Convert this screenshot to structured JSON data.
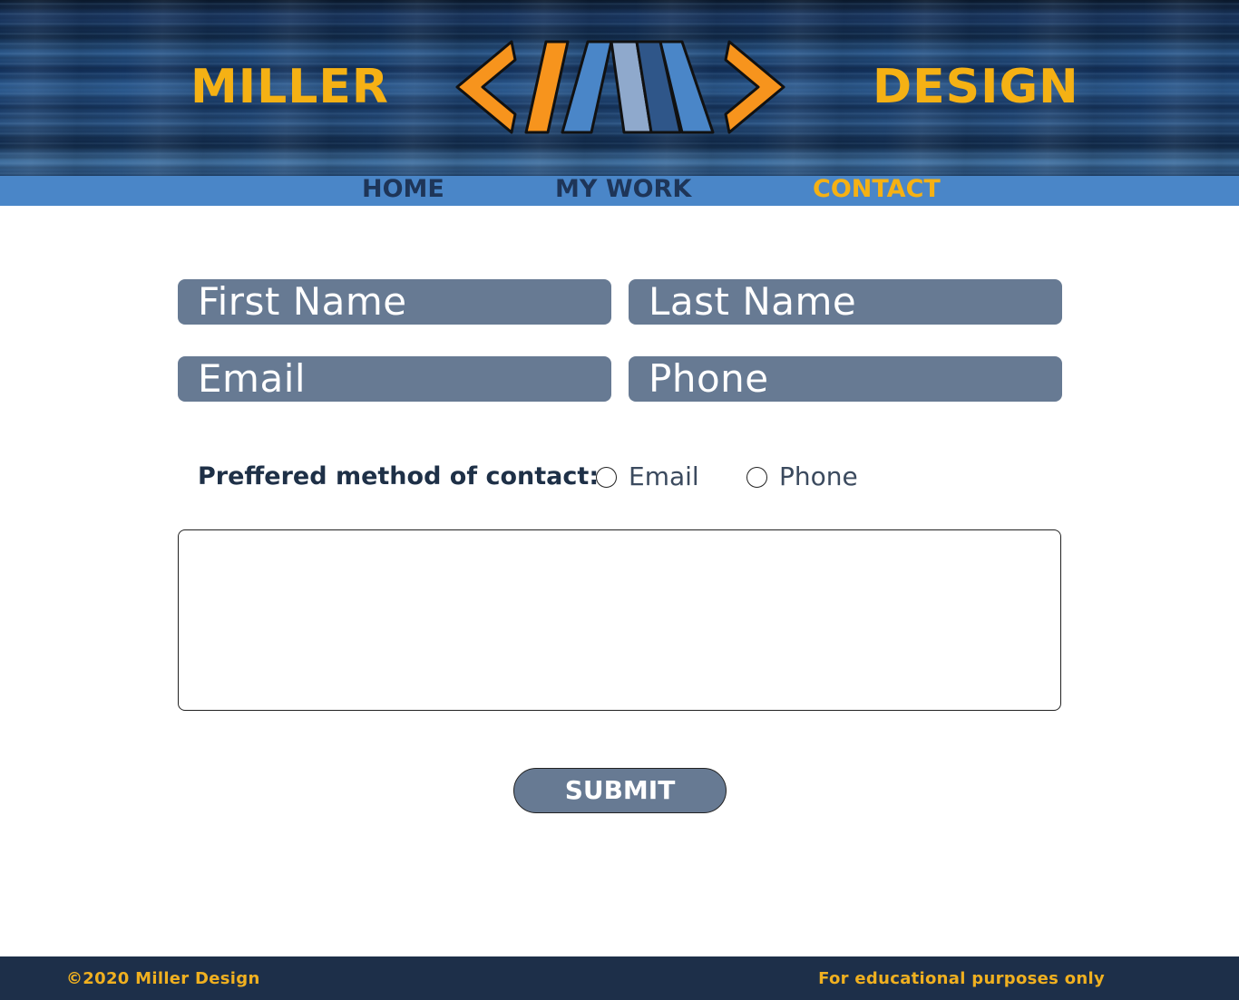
{
  "header": {
    "brand_left": "MILLER",
    "brand_right": "DESIGN",
    "logo_icon": "m-logo-icon",
    "colors": {
      "brand_yellow": "#f5b114",
      "logo_orange": "#f7941d",
      "logo_blue": "#4a86c8",
      "logo_light_blue": "#8fa9cc",
      "logo_dark_blue": "#2f5689"
    }
  },
  "nav": {
    "items": [
      {
        "label": "HOME"
      },
      {
        "label": "MY WORK"
      },
      {
        "label": "CONTACT",
        "active": true
      }
    ],
    "colors": {
      "bar": "#4a86c8",
      "text": "#1e3558",
      "active": "#f5b114"
    }
  },
  "form": {
    "first_name": {
      "placeholder": "First Name",
      "value": ""
    },
    "last_name": {
      "placeholder": "Last Name",
      "value": ""
    },
    "email": {
      "placeholder": "Email",
      "value": ""
    },
    "phone": {
      "placeholder": "Phone",
      "value": ""
    },
    "preferred_label": "Preffered method of contact:",
    "radio_options": [
      {
        "label": "Email",
        "checked": false
      },
      {
        "label": "Phone",
        "checked": false
      }
    ],
    "message": {
      "value": ""
    },
    "submit_label": "SUBMIT",
    "colors": {
      "field_bg": "#677a93",
      "field_text": "#ffffff"
    }
  },
  "footer": {
    "left": "©2020 Miller Design",
    "right": "For educational purposes only",
    "colors": {
      "bg": "#1d2f49",
      "text": "#f0b020"
    }
  }
}
